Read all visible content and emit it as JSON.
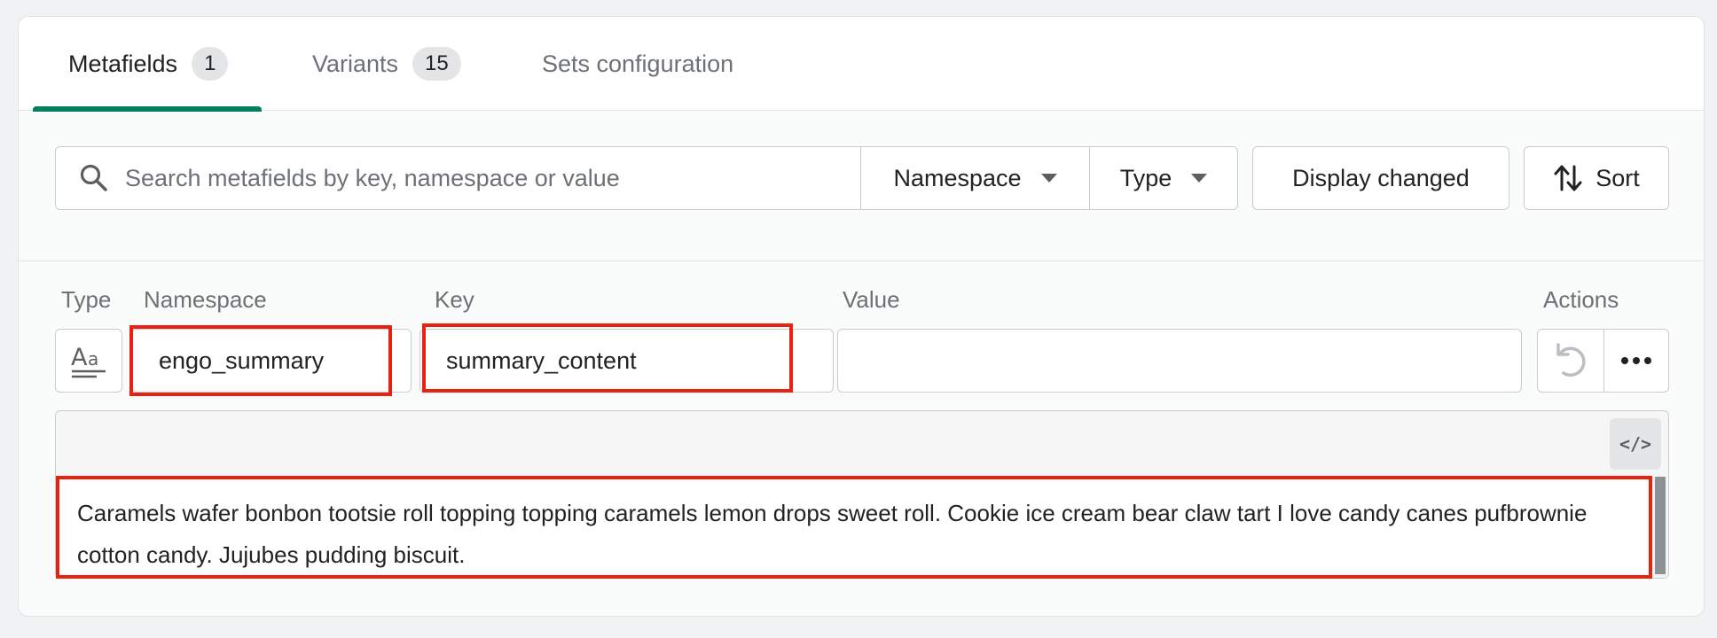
{
  "tabs": [
    {
      "label": "Metafields",
      "count": "1"
    },
    {
      "label": "Variants",
      "count": "15"
    },
    {
      "label": "Sets configuration"
    }
  ],
  "filters": {
    "search_placeholder": "Search metafields by key, namespace or value",
    "namespace_label": "Namespace",
    "type_label": "Type",
    "display_changed_label": "Display changed",
    "sort_label": "Sort"
  },
  "columns": {
    "type": "Type",
    "namespace": "Namespace",
    "key": "Key",
    "value": "Value",
    "actions": "Actions"
  },
  "row": {
    "type_icon": "rich-text-icon",
    "namespace": "engo_summary",
    "key": "summary_content",
    "value": "",
    "content": "Caramels wafer bonbon tootsie roll topping topping caramels lemon drops sweet roll. Cookie ice cream bear claw tart I love candy canes pufbrownie cotton candy. Jujubes pudding biscuit."
  },
  "editor": {
    "code_toggle_label": "</>"
  },
  "colors": {
    "accent": "#008060",
    "highlight": "#e8220f"
  }
}
